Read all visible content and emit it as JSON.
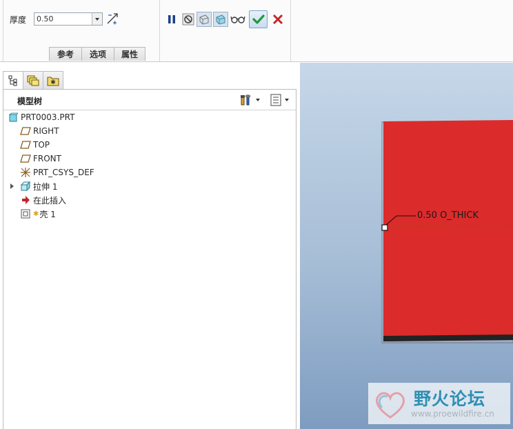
{
  "dashboard": {
    "thickness_label": "厚度",
    "thickness_value": "0.50",
    "tabs": [
      "参考",
      "选项",
      "属性"
    ],
    "tools": [
      "pause-icon",
      "no-preview-icon",
      "verify-icon",
      "preview-icon",
      "glasses-icon",
      "ok-icon",
      "cancel-icon"
    ]
  },
  "panel": {
    "tabs": [
      "model-tree-icon",
      "layers-icon",
      "favorites-icon"
    ],
    "tree_title": "模型树",
    "items": [
      {
        "label": "PRT0003.PRT",
        "icon": "part-icon"
      },
      {
        "label": "RIGHT",
        "icon": "datum-plane-icon"
      },
      {
        "label": "TOP",
        "icon": "datum-plane-icon"
      },
      {
        "label": "FRONT",
        "icon": "datum-plane-icon"
      },
      {
        "label": "PRT_CSYS_DEF",
        "icon": "csys-icon"
      },
      {
        "label": "拉伸 1",
        "icon": "extrude-icon"
      },
      {
        "label": "在此插入",
        "icon": "insert-arrow-icon"
      },
      {
        "label": "壳 1",
        "icon": "shell-icon"
      }
    ]
  },
  "viewport": {
    "dimension_label": "0.50 O_THICK",
    "part_color": "#db2b2b",
    "watermark_title": "野火论坛",
    "watermark_url": "www.proewildfire.cn"
  }
}
